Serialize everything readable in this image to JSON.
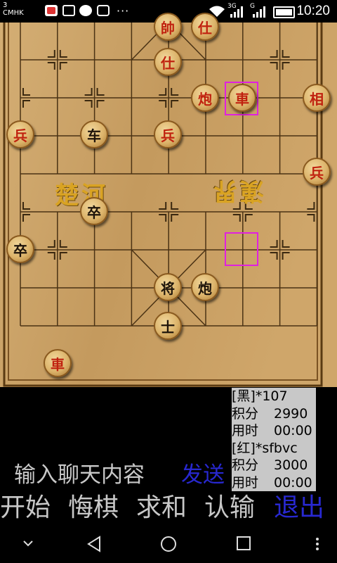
{
  "status_bar": {
    "carrier_slot": "3",
    "carrier": "CMHK",
    "network_a": "3G",
    "network_b": "G",
    "time": "10:20",
    "icons": [
      "cast-icon",
      "gallery-icon",
      "app-icon",
      "message-icon",
      "more-dots-icon",
      "wifi-icon",
      "signal-icon",
      "battery-icon"
    ]
  },
  "board": {
    "river_left": "楚河",
    "river_right": "漢界",
    "pieces": [
      {
        "id": "red-shi-top",
        "label": "仕",
        "color": "red"
      },
      {
        "id": "red-shi-upper",
        "label": "仕",
        "color": "red"
      },
      {
        "id": "red-xiang-top",
        "label": "帥",
        "color": "red"
      },
      {
        "id": "red-pao",
        "label": "炮",
        "color": "red"
      },
      {
        "id": "red-ju-top",
        "label": "車",
        "color": "red"
      },
      {
        "id": "red-xiang",
        "label": "相",
        "color": "red"
      },
      {
        "id": "red-bing-left",
        "label": "兵",
        "color": "red"
      },
      {
        "id": "black-che",
        "label": "车",
        "color": "black"
      },
      {
        "id": "red-bing-mid",
        "label": "兵",
        "color": "red"
      },
      {
        "id": "red-bing-right",
        "label": "兵",
        "color": "red"
      },
      {
        "id": "black-zu-river",
        "label": "卒",
        "color": "black"
      },
      {
        "id": "black-zu-left",
        "label": "卒",
        "color": "black"
      },
      {
        "id": "black-jiang",
        "label": "将",
        "color": "black"
      },
      {
        "id": "black-pao",
        "label": "炮",
        "color": "black"
      },
      {
        "id": "black-shi",
        "label": "士",
        "color": "black"
      },
      {
        "id": "red-ju-bottom",
        "label": "車",
        "color": "red"
      }
    ]
  },
  "players": {
    "black": {
      "side": "[黑]",
      "name": "*107",
      "score_label": "积分",
      "score": "2990",
      "time_label": "用时",
      "time": "00:00"
    },
    "red": {
      "side": "[红]",
      "name": "*sfbvc",
      "score_label": "积分",
      "score": "3000",
      "time_label": "用时",
      "time": "00:00"
    }
  },
  "chat": {
    "placeholder": "输入聊天内容",
    "send_label": "发送"
  },
  "actions": {
    "start": "开始",
    "undo": "悔棋",
    "draw": "求和",
    "resign": "认输",
    "exit": "退出"
  },
  "colors": {
    "accent_blue": "#2828d0",
    "highlight": "#e020e0",
    "board": "#c9a46a"
  }
}
